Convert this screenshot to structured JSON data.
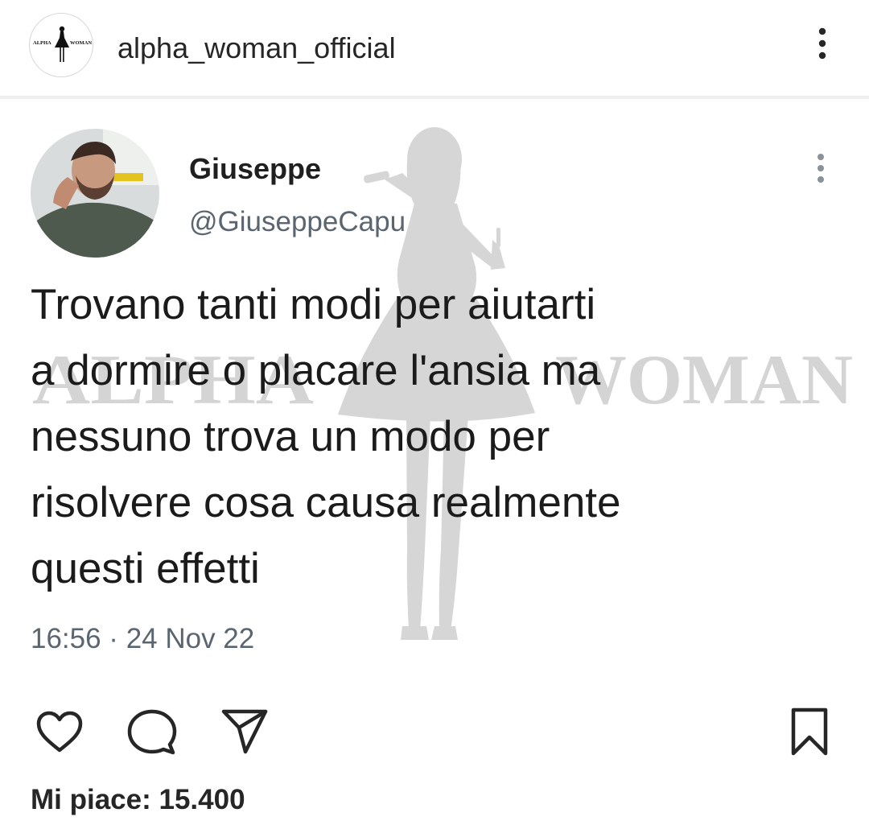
{
  "post": {
    "username": "alpha_woman_official",
    "logo_text_left": "ALPHA",
    "logo_text_right": "WOMAN",
    "likes_label": "Mi piace: 15.400"
  },
  "tweet": {
    "name": "Giuseppe",
    "handle": "@GiuseppeCapu",
    "text_lines": [
      "Trovano tanti modi per aiutarti",
      "a dormire o placare l'ansia ma",
      "nessuno trova un modo per",
      "risolvere cosa causa realmente",
      "questi effetti"
    ],
    "timestamp": "16:56 · 24 Nov 22"
  },
  "watermark": {
    "text": "ALPHA WOMAN"
  },
  "icons": {
    "header_menu": "more-vertical-icon",
    "tweet_menu": "more-vertical-icon",
    "like": "heart-icon",
    "comment": "comment-bubble-icon",
    "share": "send-paper-plane-icon",
    "save": "bookmark-icon"
  },
  "colors": {
    "text_primary": "#262626",
    "text_secondary": "#5b6570",
    "watermark": "#cfcfcf",
    "divider": "#eeeeee"
  }
}
